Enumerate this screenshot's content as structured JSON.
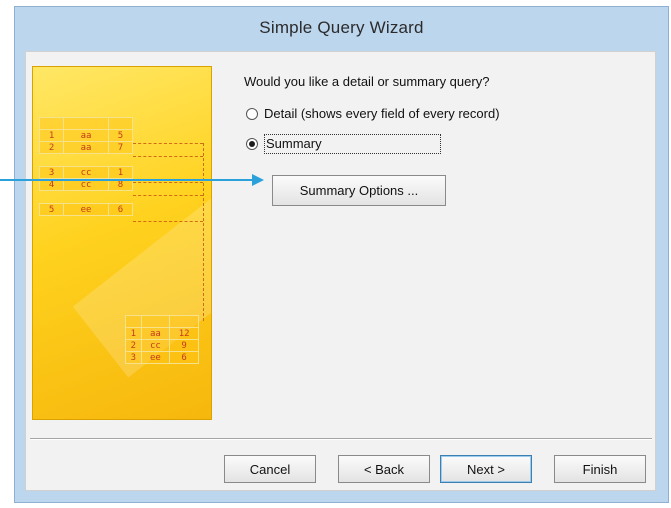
{
  "window": {
    "title": "Simple Query Wizard"
  },
  "prompt": {
    "question": "Would you like a detail or summary query?"
  },
  "options": {
    "detail": {
      "label": "Detail (shows every field of every record)",
      "selected": false
    },
    "summary": {
      "label": "Summary",
      "selected": true
    }
  },
  "summary_options_button": {
    "label": "Summary Options ..."
  },
  "illustration": {
    "detail_rows": [
      [
        "1",
        "aa",
        "5"
      ],
      [
        "2",
        "aa",
        "7"
      ],
      [
        "3",
        "cc",
        "1"
      ],
      [
        "4",
        "cc",
        "8"
      ],
      [
        "5",
        "ee",
        "6"
      ]
    ],
    "summary_rows": [
      [
        "1",
        "aa",
        "12"
      ],
      [
        "2",
        "cc",
        "9"
      ],
      [
        "3",
        "ee",
        "6"
      ]
    ]
  },
  "footer": {
    "cancel": "Cancel",
    "back": "< Back",
    "next": "Next >",
    "finish": "Finish"
  },
  "colors": {
    "callout_arrow": "#2aa1db",
    "illustration_bg": "#ffd21f",
    "titlebar_bg": "#bcd6ee"
  }
}
